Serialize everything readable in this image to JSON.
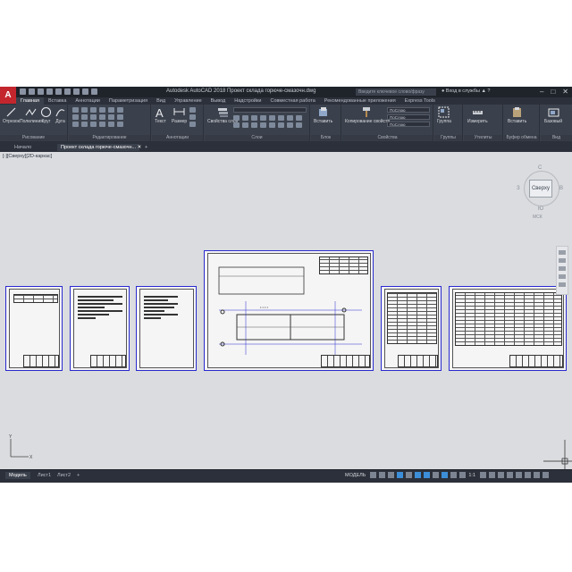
{
  "app": {
    "title": "Autodesk AutoCAD 2018   Проект склада горюче-смазочн.dwg",
    "logo_letter": "A",
    "search_placeholder": "Введите ключевое слово/фразу",
    "user": "Вход в службы",
    "window_controls": [
      "–",
      "□",
      "✕"
    ]
  },
  "ribbon_tabs": [
    "Главная",
    "Вставка",
    "Аннотации",
    "Параметризация",
    "Вид",
    "Управление",
    "Вывод",
    "Надстройки",
    "Совместная работа",
    "Рекомендованные приложения",
    "Express Tools"
  ],
  "active_ribbon_tab": "Главная",
  "panels": {
    "draw": {
      "label": "Рисование",
      "buttons": [
        "Отрезок",
        "Полилиния",
        "Круг",
        "Дуга"
      ]
    },
    "modify": {
      "label": "Редактирование"
    },
    "annotation": {
      "label": "Аннотации",
      "buttons": [
        "Текст",
        "Размер"
      ]
    },
    "layers": {
      "label": "Слои",
      "buttons": [
        "Свойства слоя"
      ]
    },
    "block": {
      "label": "Блок",
      "buttons": [
        "Вставить"
      ]
    },
    "properties": {
      "label": "Свойства",
      "buttons": [
        "Копирование свойств"
      ],
      "combos": [
        "ПоСлою",
        "ПоСлою",
        "ПоСлою"
      ]
    },
    "groups": {
      "label": "Группы",
      "buttons": [
        "Группа"
      ]
    },
    "utilities": {
      "label": "Утилиты",
      "buttons": [
        "Измерить"
      ]
    },
    "clipboard": {
      "label": "Буфер обмена",
      "buttons": [
        "Вставить"
      ]
    },
    "view": {
      "label": "Вид",
      "buttons": [
        "Базовый"
      ]
    }
  },
  "file_tabs": [
    "Начало",
    "Проект склада горюче-смазочн..."
  ],
  "viewport_label": "[-][Сверху][2D-каркас]",
  "viewcube": {
    "face": "Сверху",
    "compass": {
      "north": "С",
      "south": "Ю",
      "east": "В",
      "west": "З"
    },
    "wcs": "МСК"
  },
  "layout_tabs": [
    "Модель",
    "Лист1",
    "Лист2",
    "+"
  ],
  "status_bar": {
    "model_label": "МОДЕЛЬ",
    "scale": "1:1"
  },
  "colors": {
    "title_bar": "#1f232a",
    "ribbon": "#3b414c",
    "canvas": "#dadcdf",
    "sheet_border": "#2a2ad0",
    "accent": "#3c8ed8",
    "logo": "#c4262e"
  }
}
